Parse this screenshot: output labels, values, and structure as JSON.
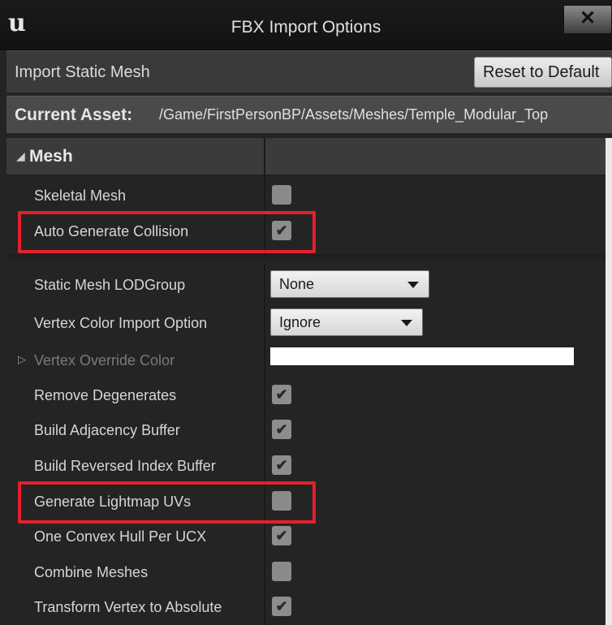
{
  "window": {
    "logo": "u",
    "title": "FBX Import Options",
    "close_icon": "close-icon",
    "close_glyph": "✕"
  },
  "toolbar": {
    "label": "Import Static Mesh",
    "reset_label": "Reset to Default"
  },
  "asset": {
    "label": "Current Asset:",
    "path": "/Game/FirstPersonBP/Assets/Meshes/Temple_Modular_Top"
  },
  "section": {
    "title": "Mesh",
    "arrow": "◢"
  },
  "rows": {
    "skeletal_mesh": {
      "label": "Skeletal Mesh",
      "checked": false
    },
    "auto_generate_collision": {
      "label": "Auto Generate Collision",
      "checked": true,
      "mark": "✔"
    },
    "lod_group": {
      "label": "Static Mesh LODGroup",
      "value": "None"
    },
    "vertex_color_import": {
      "label": "Vertex Color Import Option",
      "value": "Ignore"
    },
    "vertex_override_color": {
      "label": "Vertex Override Color",
      "expander": "▷",
      "color": "#ffffff"
    },
    "remove_degenerates": {
      "label": "Remove Degenerates",
      "checked": true,
      "mark": "✔"
    },
    "build_adjacency_buffer": {
      "label": "Build Adjacency Buffer",
      "checked": true,
      "mark": "✔"
    },
    "build_reversed_index_buffer": {
      "label": "Build Reversed Index Buffer",
      "checked": true,
      "mark": "✔"
    },
    "generate_lightmap_uvs": {
      "label": "Generate Lightmap UVs",
      "checked": false
    },
    "one_convex_hull": {
      "label": "One Convex Hull Per UCX",
      "checked": true,
      "mark": "✔"
    },
    "combine_meshes": {
      "label": "Combine Meshes",
      "checked": false
    },
    "transform_vertex_absolute": {
      "label": "Transform Vertex to Absolute",
      "checked": true,
      "mark": "✔"
    }
  },
  "highlight_color": "#e4202a"
}
